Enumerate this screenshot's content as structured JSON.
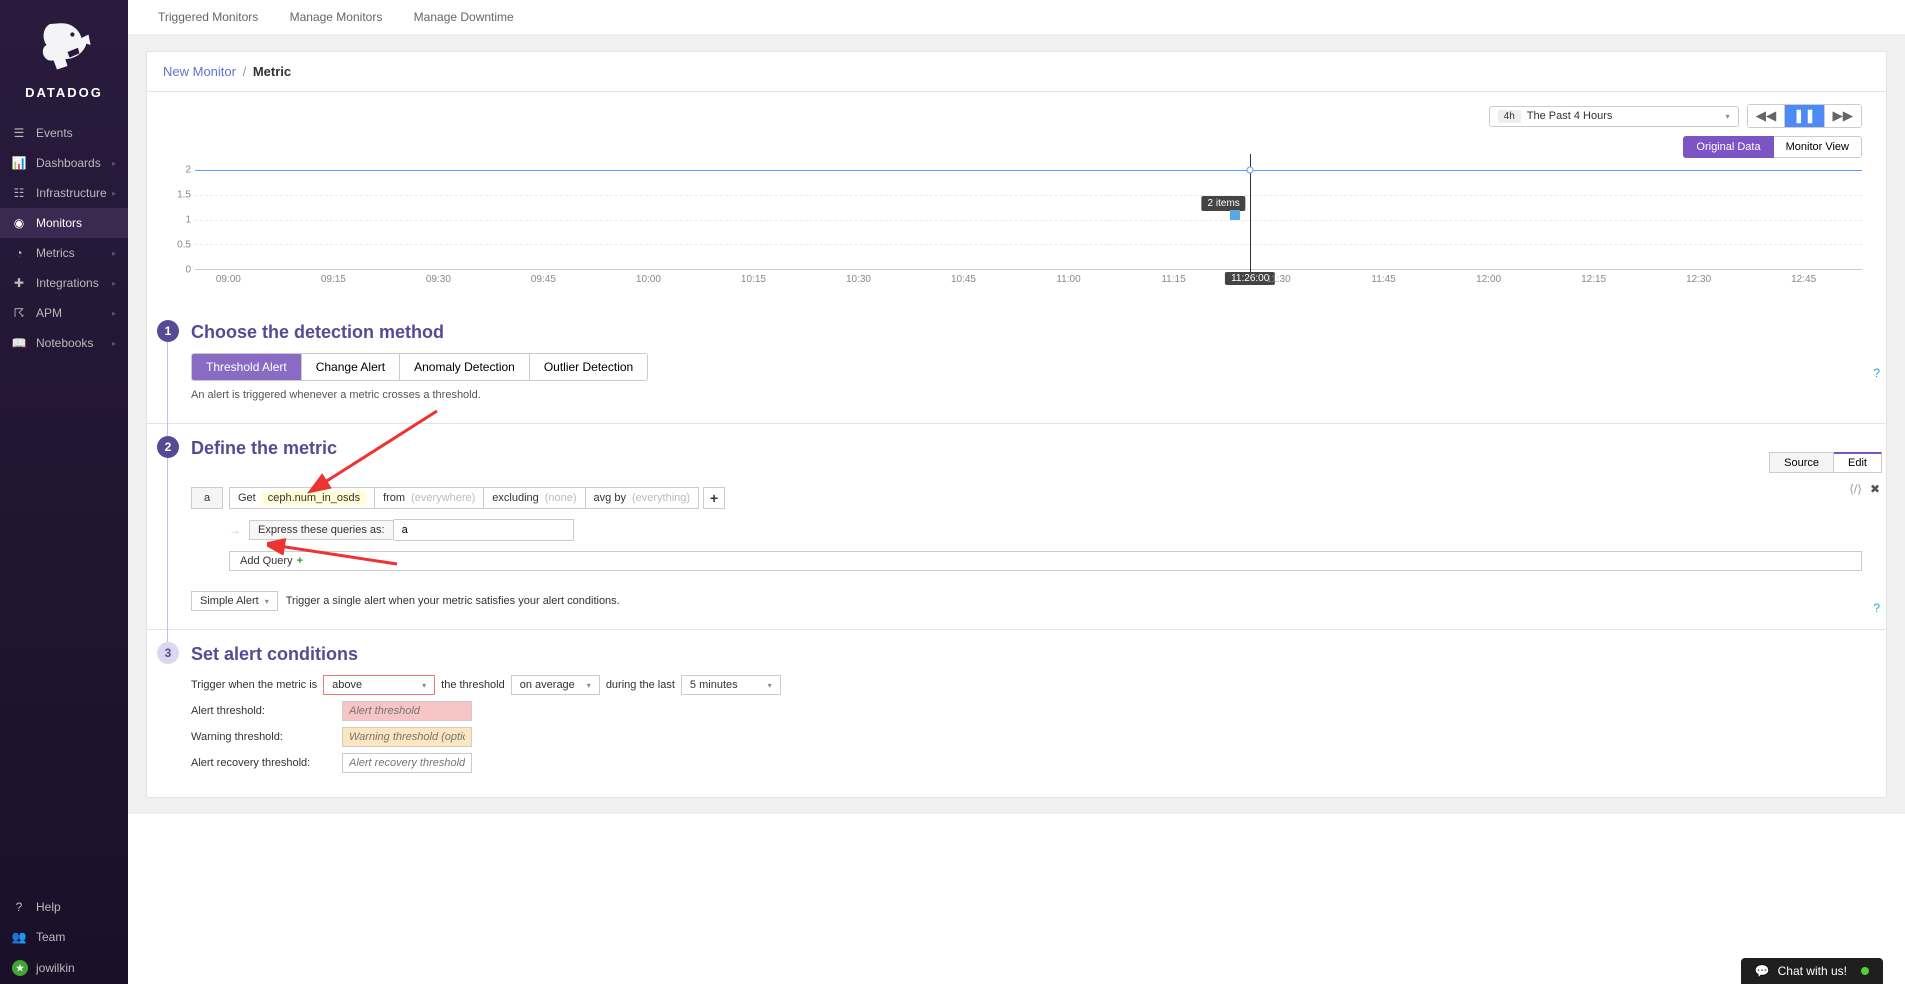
{
  "sidebar": {
    "brand": "DATADOG",
    "items": [
      {
        "label": "Events",
        "icon": "calendar"
      },
      {
        "label": "Dashboards",
        "icon": "chart"
      },
      {
        "label": "Infrastructure",
        "icon": "server"
      },
      {
        "label": "Monitors",
        "icon": "alert",
        "active": true
      },
      {
        "label": "Metrics",
        "icon": "gauge"
      },
      {
        "label": "Integrations",
        "icon": "puzzle"
      },
      {
        "label": "APM",
        "icon": "apm"
      },
      {
        "label": "Notebooks",
        "icon": "book"
      }
    ],
    "bottom": [
      {
        "label": "Help",
        "icon": "help"
      },
      {
        "label": "Team",
        "icon": "team"
      },
      {
        "label": "jowilkin",
        "icon": "avatar"
      }
    ]
  },
  "topnav": {
    "items": [
      "Triggered Monitors",
      "Manage Monitors",
      "Manage Downtime"
    ]
  },
  "breadcrumb": {
    "parent": "New Monitor",
    "sep": "/",
    "current": "Metric"
  },
  "time_range": {
    "tag": "4h",
    "label": "The Past 4 Hours"
  },
  "view_toggle": {
    "original": "Original Data",
    "monitor": "Monitor View"
  },
  "chart_data": {
    "type": "line",
    "series": [
      {
        "name": "ceph.num_in_osds",
        "constant_value": 2
      }
    ],
    "ylim": [
      0,
      2
    ],
    "yticks": [
      0,
      0.5,
      1,
      1.5,
      2
    ],
    "xticks": [
      "09:00",
      "09:15",
      "09:30",
      "09:45",
      "10:00",
      "10:15",
      "10:30",
      "10:45",
      "11:00",
      "11:15",
      "11:30",
      "11:45",
      "12:00",
      "12:15",
      "12:30",
      "12:45"
    ],
    "cursor_time": "11:26:00",
    "tooltip": "2 items",
    "xlabel": "",
    "ylabel": ""
  },
  "step1": {
    "title": "Choose the detection method",
    "options": [
      "Threshold Alert",
      "Change Alert",
      "Anomaly Detection",
      "Outlier Detection"
    ],
    "desc": "An alert is triggered whenever a metric crosses a threshold."
  },
  "step2": {
    "title": "Define the metric",
    "tabs": {
      "source": "Source",
      "edit": "Edit"
    },
    "query": {
      "a": "a",
      "get": "Get",
      "metric": "ceph.num_in_osds",
      "from": "from",
      "from_ph": "(everywhere)",
      "excluding": "excluding",
      "excluding_ph": "(none)",
      "avgby": "avg by",
      "avgby_ph": "(everything)"
    },
    "express_label": "Express these queries as:",
    "express_value": "a",
    "add_query": "Add Query",
    "simple_select": "Simple Alert",
    "simple_desc": "Trigger a single alert when your metric satisfies your alert conditions."
  },
  "step3": {
    "title": "Set alert conditions",
    "trigger_pre": "Trigger when the metric is",
    "above": "above",
    "threshold_label": "the threshold",
    "on_avg": "on average",
    "during": "during the last",
    "minutes": "5 minutes",
    "alert_label": "Alert threshold:",
    "alert_ph": "Alert threshold",
    "warn_label": "Warning threshold:",
    "warn_ph": "Warning threshold (optional)",
    "recovery_label": "Alert recovery threshold:",
    "recovery_ph": "Alert recovery threshold (option)"
  },
  "chat": {
    "label": "Chat with us!"
  }
}
